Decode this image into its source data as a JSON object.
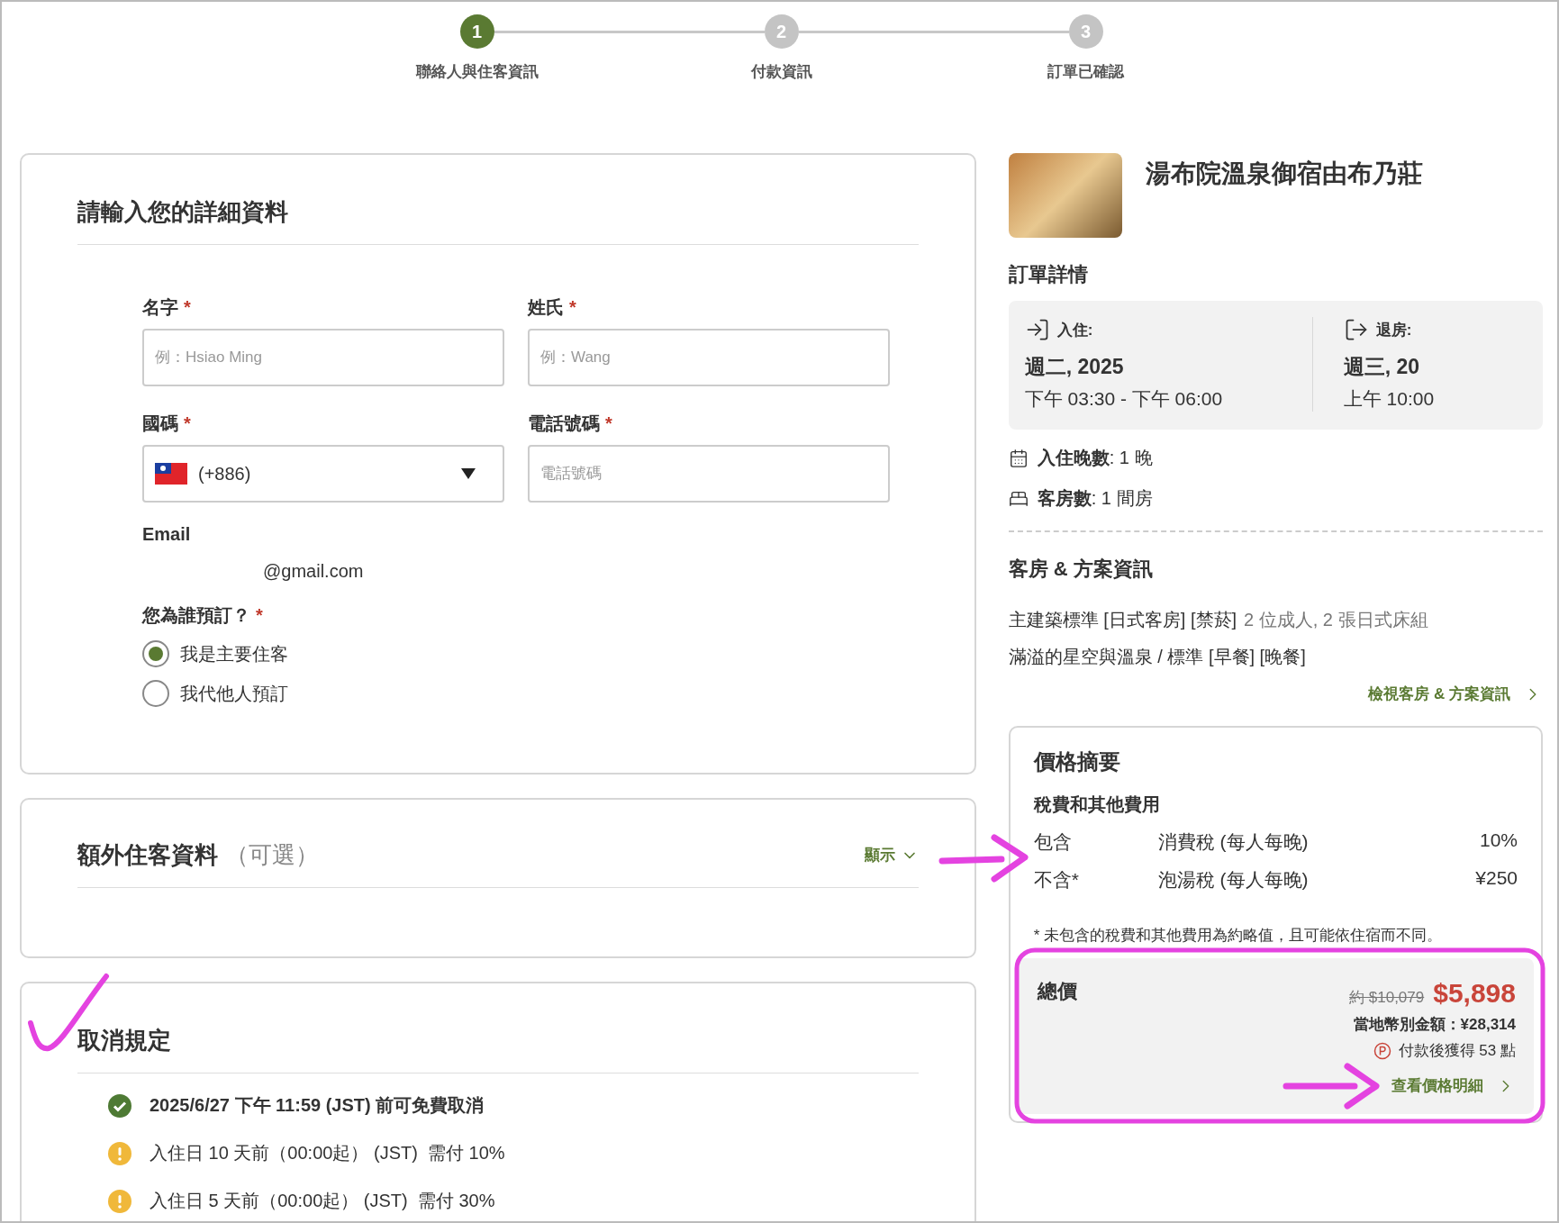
{
  "stepper": {
    "steps": [
      {
        "number": "1",
        "label": "聯絡人與住客資訊",
        "selected": true
      },
      {
        "number": "2",
        "label": "付款資訊",
        "selected": false
      },
      {
        "number": "3",
        "label": "訂單已確認",
        "selected": false
      }
    ]
  },
  "details_form": {
    "title": "請輸入您的詳細資料",
    "required_marker": "*",
    "fields": [
      {
        "kind": "text",
        "label": "名字",
        "required": true,
        "placeholder": "例：Hsiao Ming"
      },
      {
        "kind": "text",
        "label": "姓氏",
        "required": true,
        "placeholder": "例：Wang"
      },
      {
        "kind": "select",
        "label": "國碼",
        "required": true,
        "value": "(+886)"
      },
      {
        "kind": "text",
        "label": "電話號碼",
        "required": true,
        "placeholder": "電話號碼"
      }
    ],
    "email": {
      "label": "Email",
      "value": "@gmail.com"
    },
    "booking_for": {
      "label": "您為誰預訂？",
      "required": true,
      "options": [
        {
          "label": "我是主要住客",
          "selected": true
        },
        {
          "label": "我代他人預訂",
          "selected": false
        }
      ]
    }
  },
  "extra_guests": {
    "title": "額外住客資料",
    "note": "（可選）",
    "toggle": "顯示"
  },
  "cancellation": {
    "title": "取消規定",
    "rules": [
      {
        "kind": "free",
        "text": "2025/6/27 下午 11:59 (JST) 前可免費取消"
      },
      {
        "kind": "warning",
        "text": "入住日 10 天前（00:00起） (JST)  需付 10%"
      },
      {
        "kind": "warning",
        "text": "入住日 5 天前（00:00起） (JST)  需付 30%"
      }
    ]
  },
  "hotel": {
    "name": "湯布院溫泉御宿由布乃莊"
  },
  "order": {
    "title": "訂單詳情",
    "checkin": {
      "label": "入住:",
      "date": "週二, 2025",
      "time": "下午 03:30 - 下午 06:00"
    },
    "checkout": {
      "label": "退房:",
      "date": "週三, 20",
      "time": "上午 10:00"
    },
    "nights": "**入住晚數**: 1 晚",
    "rooms": "**客房數**: 1 間房"
  },
  "room_plan": {
    "title": "客房 & 方案資訊",
    "lines": [
      {
        "text": "主建築標準 [日式客房] [禁菸]",
        "detail": "2 位成人, 2 張日式床組"
      },
      {
        "text": "滿溢的星空與溫泉 / 標準 [早餐] [晚餐]"
      }
    ],
    "link": "檢視客房 & 方案資訊"
  },
  "price_summary": {
    "title": "價格摘要",
    "subtitle": "稅費和其他費用",
    "taxes": [
      {
        "status": "包含",
        "name": "消費稅 (每人每晚)",
        "amount": "10%"
      },
      {
        "status": "不含*",
        "name": "泡湯稅 (每人每晚)",
        "amount": "¥250"
      }
    ],
    "footnote": "* 未包含的稅費和其他費用為約略值，且可能依住宿而不同。",
    "total": {
      "label": "總價",
      "original": "約 $10,079",
      "price": "$5,898",
      "local": "當地幣別金額：¥28,314",
      "points": "付款後獲得 53 點",
      "link": "查看價格明細"
    }
  }
}
